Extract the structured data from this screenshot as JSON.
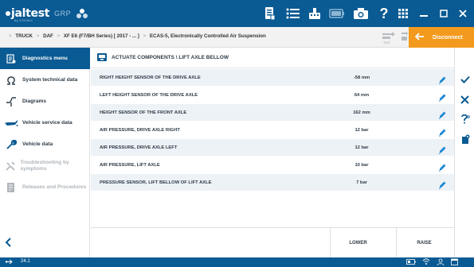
{
  "app": {
    "brand": "jaltest",
    "subbrand": "by COJALI",
    "module": "GRP",
    "help": "?",
    "version": "24.1"
  },
  "breadcrumb": {
    "items": [
      "TRUCK",
      "DAF",
      "XF E6 (F7/BH Series) [ 2017 - ... ]",
      "ECAS-5, Electronically Controlled Air Suspension"
    ]
  },
  "toolbar": {
    "test_label": "TEST",
    "disconnect_label": "Disconnect"
  },
  "sidebar": {
    "items": [
      {
        "label": "Diagnostics menu",
        "icon": "diagnostics-icon",
        "state": "active"
      },
      {
        "label": "System technical data",
        "icon": "ohm-icon",
        "state": "normal"
      },
      {
        "label": "Diagrams",
        "icon": "diagram-icon",
        "state": "normal"
      },
      {
        "label": "Vehicle service data",
        "icon": "oil-can-icon",
        "state": "normal"
      },
      {
        "label": "Vehicle data",
        "icon": "wrench-icon",
        "state": "normal"
      },
      {
        "label": "Troubleshooting by symptoms",
        "icon": "tools-icon",
        "state": "disabled"
      },
      {
        "label": "Releases and Procedures",
        "icon": "document-icon",
        "state": "disabled"
      }
    ]
  },
  "main": {
    "title": "ACTUATE COMPONENTS \\ LIFT AXLE BELLOW",
    "rows": [
      {
        "name": "RIGHT HEIGHT SENSOR OF THE DRIVE AXLE",
        "value": "-58 mm"
      },
      {
        "name": "LEFT HEIGHT SENSOR OF THE DRIVE AXLE",
        "value": "64 mm"
      },
      {
        "name": "HEIGHT SENSOR OF THE FRONT AXLE",
        "value": "162 mm"
      },
      {
        "name": "AIR PRESSURE, DRIVE AXLE RIGHT",
        "value": "12 bar"
      },
      {
        "name": "AIR PRESSURE, DRIVE AXLE LEFT",
        "value": "12 bar"
      },
      {
        "name": "AIR PRESSURE, LIFT AXLE",
        "value": "10 bar"
      },
      {
        "name": "PRESSURE SENSOR, LIFT BELLOW OF LIFT AXLE",
        "value": "7 bar"
      }
    ],
    "footer": {
      "lower_label": "LOWER",
      "raise_label": "RAISE"
    }
  },
  "colors": {
    "primary": "#0a5a93",
    "accent": "#f39a1e",
    "row_alt": "#edf2f7"
  }
}
